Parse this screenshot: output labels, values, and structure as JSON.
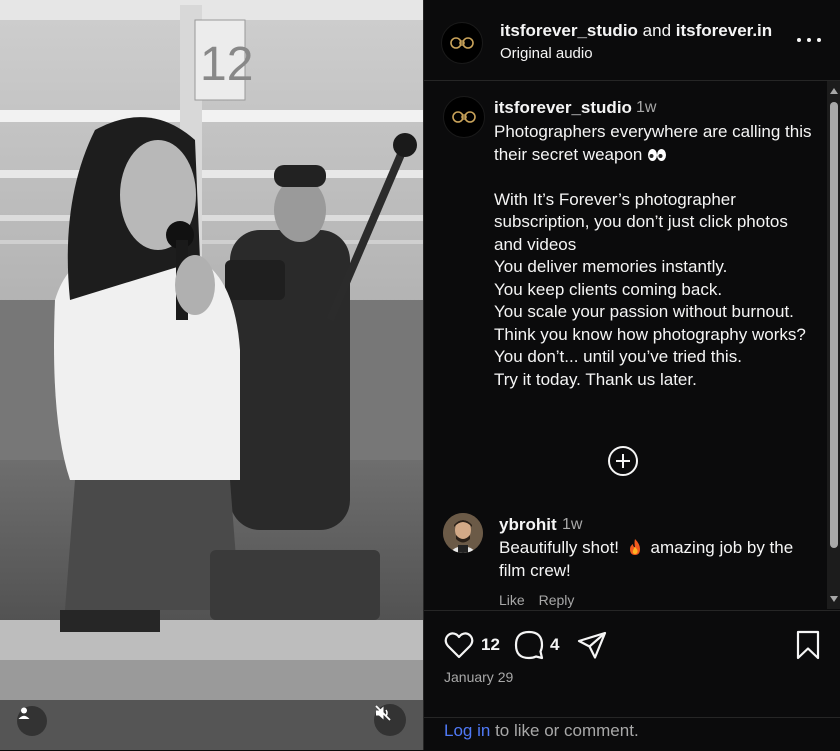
{
  "header": {
    "author_primary": "itsforever_studio",
    "author_conjunction": "and",
    "author_secondary": "itsforever.in",
    "audio_label": "Original audio",
    "more_icon": "more-horizontal-icon"
  },
  "caption": {
    "username": "itsforever_studio",
    "time": "1w",
    "lines": [
      "Photographers everywhere are calling this their secret weapon",
      "With It’s Forever’s photographer subscription, you don’t just click photos and videos",
      "You deliver memories instantly.",
      "You keep clients coming back.",
      "You scale your passion without burnout.",
      "Think you know how photography works?",
      "You don’t... until you’ve tried this.",
      "Try it today. Thank us later."
    ]
  },
  "load_more_icon": "plus-circle-icon",
  "comment": {
    "username": "ybrohit",
    "time": "1w",
    "text_before": "Beautifully shot!",
    "text_after": "amazing job by the film crew!",
    "like_label": "Like",
    "reply_label": "Reply"
  },
  "actions": {
    "like_count": "12",
    "comment_count": "4",
    "date": "January 29"
  },
  "login": {
    "link_label": "Log in",
    "rest": "to like or comment."
  },
  "colors": {
    "background": "#0b0b0c",
    "text": "#f5f5f5",
    "secondary_text": "#a8a8a8",
    "link": "#4f79f6",
    "border": "#262626"
  }
}
